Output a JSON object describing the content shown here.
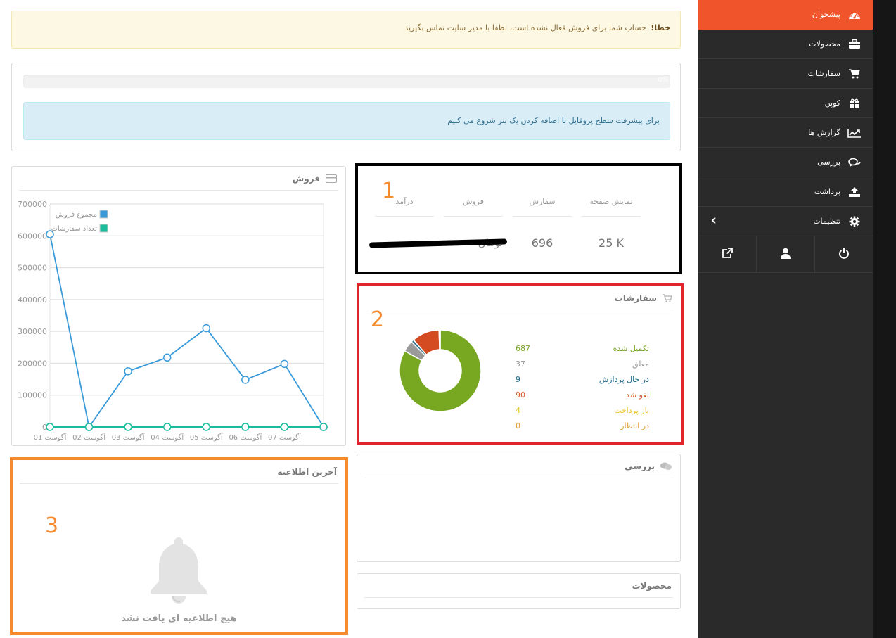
{
  "alert": {
    "title": "خطا!",
    "message": "حساب شما برای فروش فعال نشده است، لطفا با مدیر سایت تماس بگیرید"
  },
  "profile": {
    "progress": 0,
    "progress_label": "0%",
    "info": "برای پیشرفت سطح پروفایل با اضافه کردن یک بنر شروع می کنیم"
  },
  "sales_panel": {
    "title": "فروش",
    "chart_data": {
      "type": "line",
      "categories": [
        "01 آگوست",
        "02 آگوست",
        "03 آگوست",
        "04 آگوست",
        "05 آگوست",
        "06 آگوست",
        "07 آگوست",
        ""
      ],
      "series": [
        {
          "name": "مجموع فروش",
          "color": "#3a9ad9",
          "values": [
            605000,
            0,
            175000,
            218000,
            310000,
            148000,
            198000,
            0
          ]
        },
        {
          "name": "تعداد سفارشات",
          "color": "#1abc9c",
          "values": [
            0,
            0,
            0,
            0,
            0,
            0,
            0,
            0
          ]
        }
      ],
      "yticks": [
        "700000",
        "600000",
        "500000",
        "400000",
        "300000",
        "200000",
        "100000",
        "0"
      ],
      "ylim": [
        0,
        700000
      ],
      "grid": true,
      "legend": "top-left"
    }
  },
  "stats": {
    "headers": [
      "نمایش صفحه",
      "سفارش",
      "فروش",
      "درآمد"
    ],
    "values": [
      "25 K",
      "696",
      "",
      ""
    ],
    "hidden_text": "تومان"
  },
  "orders_panel": {
    "title": "سفارشات",
    "statuses": [
      {
        "label": "تکمیل شده",
        "value": "687",
        "color": "#7aa52a"
      },
      {
        "label": "معلق",
        "value": "37",
        "color": "#999999"
      },
      {
        "label": "در حال پردازش",
        "value": "9",
        "color": "#1f6b8c"
      },
      {
        "label": "لغو شد",
        "value": "90",
        "color": "#d9532c"
      },
      {
        "label": "باز پرداخت",
        "value": "4",
        "color": "#e8c326"
      },
      {
        "label": "در انتظار",
        "value": "0",
        "color": "#e09a2e"
      }
    ],
    "chart_data": {
      "type": "pie",
      "values": [
        687,
        37,
        9,
        90,
        4,
        0
      ],
      "colors": [
        "#78a822",
        "#9a9a9a",
        "#2b6f8e",
        "#d54b21",
        "#e8c326",
        "#e09a2e"
      ]
    }
  },
  "notifications": {
    "title": "آخرین اطلاعیه",
    "empty_text": "هیچ اطلاعیه ای یافت نشد"
  },
  "review_panel": {
    "title": "بررسی"
  },
  "products_panel": {
    "title": "محصولات"
  },
  "markers": {
    "m1": "1",
    "m2": "2",
    "m3": "3"
  },
  "sidebar": {
    "items": [
      {
        "label": "پیشخوان",
        "icon": "dashboard-icon"
      },
      {
        "label": "محصولات",
        "icon": "briefcase-icon"
      },
      {
        "label": "سفارشات",
        "icon": "cart-icon"
      },
      {
        "label": "کوپن",
        "icon": "gift-icon"
      },
      {
        "label": "گزارش ها",
        "icon": "chart-icon"
      },
      {
        "label": "بررسی",
        "icon": "comments-icon"
      },
      {
        "label": "برداشت",
        "icon": "upload-icon"
      },
      {
        "label": "تنظیمات",
        "icon": "gear-icon"
      }
    ],
    "bottom": [
      "external-link-icon",
      "user-icon",
      "power-icon"
    ]
  }
}
